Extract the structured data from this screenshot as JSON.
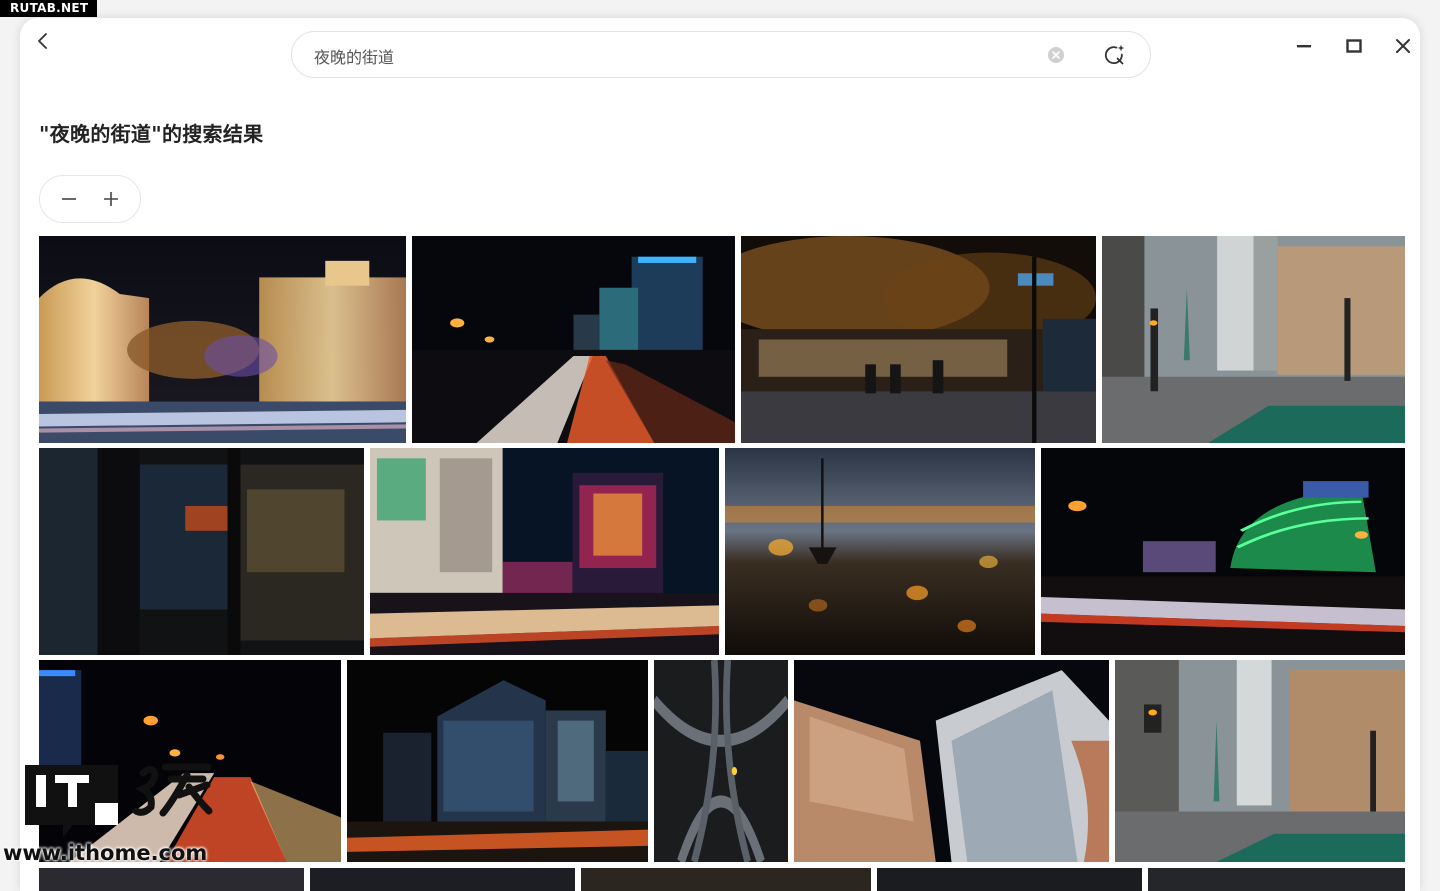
{
  "badge": "RUTAB.NET",
  "search": {
    "query": "夜晚的街道"
  },
  "results": {
    "title": "\"夜晚的街道\"的搜索结果"
  },
  "watermark": {
    "url": "www.ithome.com"
  }
}
